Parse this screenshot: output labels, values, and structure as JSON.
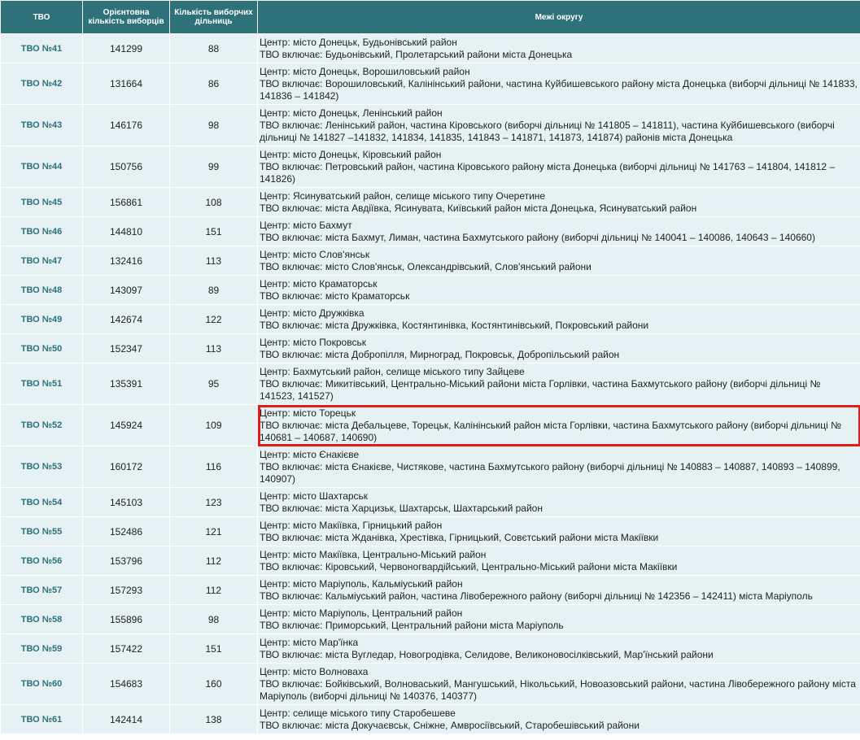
{
  "headers": {
    "tvo": "ТВО",
    "voters": "Орієнтовна кількість виборців",
    "stations": "Кількість виборчих дільниць",
    "bounds": "Межі округу"
  },
  "rows": [
    {
      "tvo": "ТВО №41",
      "voters": "141299",
      "stations": "88",
      "center": "Центр: місто Донецьк, Будьонівський район",
      "includes": "ТВО включає: Будьонівський, Пролетарський райони міста Донецька"
    },
    {
      "tvo": "ТВО №42",
      "voters": "131664",
      "stations": "86",
      "center": "Центр: місто Донецьк, Ворошиловський район",
      "includes": "ТВО включає: Ворошиловський, Калінінський райони, частина Куйбишевського району міста Донецька (виборчі дільниці № 141833, 141836 – 141842)"
    },
    {
      "tvo": "ТВО №43",
      "voters": "146176",
      "stations": "98",
      "center": "Центр: місто Донецьк, Ленінський район",
      "includes": "ТВО включає: Ленінський район, частина Кіровського (виборчі дільниці № 141805 – 141811), частина Куйбишевського (виборчі дільниці № 141827 –141832, 141834, 141835, 141843 – 141871, 141873, 141874) районів міста Донецька"
    },
    {
      "tvo": "ТВО №44",
      "voters": "150756",
      "stations": "99",
      "center": "Центр: місто Донецьк, Кіровський район",
      "includes": "ТВО включає: Петровський район, частина Кіровського району міста Донецька (виборчі дільниці № 141763 – 141804, 141812 – 141826)"
    },
    {
      "tvo": "ТВО №45",
      "voters": "156861",
      "stations": "108",
      "center": "Центр: Ясинуватський район, селище міського типу Очеретине",
      "includes": "ТВО включає: міста Авдіївка, Ясинувата, Київський район міста Донецька, Ясинуватський район"
    },
    {
      "tvo": "ТВО №46",
      "voters": "144810",
      "stations": "151",
      "center": "Центр: місто Бахмут",
      "includes": "ТВО включає: міста Бахмут, Лиман, частина Бахмутського району (виборчі дільниці № 140041 – 140086, 140643 – 140660)"
    },
    {
      "tvo": "ТВО №47",
      "voters": "132416",
      "stations": "113",
      "center": "Центр: місто Слов'янськ",
      "includes": "ТВО включає: місто Слов'янськ, Олександрівський, Слов'янський райони"
    },
    {
      "tvo": "ТВО №48",
      "voters": "143097",
      "stations": "89",
      "center": "Центр: місто Краматорськ",
      "includes": "ТВО включає: місто Краматорськ"
    },
    {
      "tvo": "ТВО №49",
      "voters": "142674",
      "stations": "122",
      "center": "Центр: місто Дружківка",
      "includes": "ТВО включає: міста Дружківка, Костянтинівка, Костянтинівський, Покровський райони"
    },
    {
      "tvo": "ТВО №50",
      "voters": "152347",
      "stations": "113",
      "center": "Центр: місто Покровськ",
      "includes": "ТВО включає: міста Добропілля, Мирноград, Покровськ, Добропільський район"
    },
    {
      "tvo": "ТВО №51",
      "voters": "135391",
      "stations": "95",
      "center": "Центр: Бахмутський район, селище міського типу Зайцеве",
      "includes": "ТВО включає: Микитівський, Центрально-Міський райони міста Горлівки, частина Бахмутського району (виборчі дільниці № 141523, 141527)"
    },
    {
      "tvo": "ТВО №52",
      "voters": "145924",
      "stations": "109",
      "center": "Центр: місто Торецьк",
      "includes": "ТВО включає: міста Дебальцеве, Торецьк, Калінінський район міста Горлівки, частина Бахмутського району (виборчі дільниці № 140681 – 140687, 140690)",
      "highlight": true
    },
    {
      "tvo": "ТВО №53",
      "voters": "160172",
      "stations": "116",
      "center": "Центр: місто Єнакієве",
      "includes": "ТВО включає: міста Єнакієве, Чистякове, частина Бахмутського району (виборчі дільниці № 140883 – 140887, 140893 – 140899, 140907)"
    },
    {
      "tvo": "ТВО №54",
      "voters": "145103",
      "stations": "123",
      "center": "Центр: місто Шахтарськ",
      "includes": "ТВО включає: міста Харцизьк, Шахтарськ, Шахтарський район"
    },
    {
      "tvo": "ТВО №55",
      "voters": "152486",
      "stations": "121",
      "center": "Центр: місто Макіївка, Гірницький район",
      "includes": "ТВО включає: міста Жданівка, Хрестівка, Гірницький, Совєтський райони міста Макіївки"
    },
    {
      "tvo": "ТВО №56",
      "voters": "153796",
      "stations": "112",
      "center": "Центр: місто Макіївка, Центрально-Міський район",
      "includes": "ТВО включає: Кіровський, Червоногвардійський, Центрально-Міський райони міста Макіївки"
    },
    {
      "tvo": "ТВО №57",
      "voters": "157293",
      "stations": "112",
      "center": "Центр: місто Маріуполь, Кальміуський район",
      "includes": "ТВО включає: Кальміуський район, частина Лівобережного району (виборчі дільниці № 142356 – 142411) міста Маріуполь"
    },
    {
      "tvo": "ТВО №58",
      "voters": "155896",
      "stations": "98",
      "center": "Центр: місто Маріуполь, Центральний район",
      "includes": "ТВО включає: Приморський, Центральний райони міста Маріуполь"
    },
    {
      "tvo": "ТВО №59",
      "voters": "157422",
      "stations": "151",
      "center": "Центр: місто Мар'їнка",
      "includes": "ТВО включає: міста Вугледар, Новогродівка, Селидове, Великоновосілківський, Мар'їнський райони"
    },
    {
      "tvo": "ТВО №60",
      "voters": "154683",
      "stations": "160",
      "center": "Центр: місто Волноваха",
      "includes": "ТВО включає: Бойківський, Волноваський, Мангушський, Нікольський, Новоазовський райони, частина Лівобережного району міста Маріуполь (виборчі дільниці № 140376, 140377)"
    },
    {
      "tvo": "ТВО №61",
      "voters": "142414",
      "stations": "138",
      "center": "Центр: селище міського типу Старобешеве",
      "includes": "ТВО включає: міста Докучаєвськ, Сніжне, Амвросіївський, Старобешівський райони"
    }
  ]
}
